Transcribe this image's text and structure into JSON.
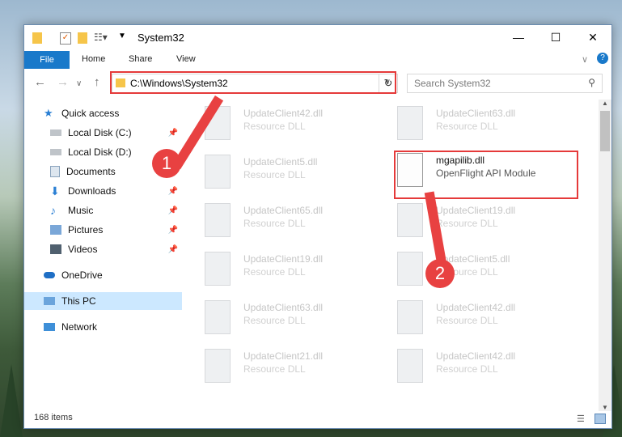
{
  "window": {
    "title": "System32"
  },
  "ribbon": {
    "file": "File",
    "home": "Home",
    "share": "Share",
    "view": "View"
  },
  "navbar": {
    "address": "C:\\Windows\\System32",
    "search_placeholder": "Search System32"
  },
  "sidebar": {
    "items": [
      {
        "label": "Quick access"
      },
      {
        "label": "Local Disk (C:)"
      },
      {
        "label": "Local Disk (D:)"
      },
      {
        "label": "Documents"
      },
      {
        "label": "Downloads"
      },
      {
        "label": "Music"
      },
      {
        "label": "Pictures"
      },
      {
        "label": "Videos"
      },
      {
        "label": "OneDrive"
      },
      {
        "label": "This PC"
      },
      {
        "label": "Network"
      }
    ]
  },
  "files": [
    {
      "name": "UpdateClient42.dll",
      "desc": "Resource DLL"
    },
    {
      "name": "UpdateClient63.dll",
      "desc": "Resource DLL"
    },
    {
      "name": "UpdateClient5.dll",
      "desc": "Resource DLL"
    },
    {
      "name": "mgapilib.dll",
      "desc": "OpenFlight API Module"
    },
    {
      "name": "UpdateClient65.dll",
      "desc": "Resource DLL"
    },
    {
      "name": "UpdateClient19.dll",
      "desc": "Resource DLL"
    },
    {
      "name": "UpdateClient19.dll",
      "desc": "Resource DLL"
    },
    {
      "name": "UpdateClient5.dll",
      "desc": "Resource DLL"
    },
    {
      "name": "UpdateClient63.dll",
      "desc": "Resource DLL"
    },
    {
      "name": "UpdateClient42.dll",
      "desc": "Resource DLL"
    },
    {
      "name": "UpdateClient21.dll",
      "desc": "Resource DLL"
    },
    {
      "name": "UpdateClient42.dll",
      "desc": "Resource DLL"
    }
  ],
  "status": {
    "items": "168 items"
  },
  "annotations": {
    "step1": "1",
    "step2": "2"
  }
}
